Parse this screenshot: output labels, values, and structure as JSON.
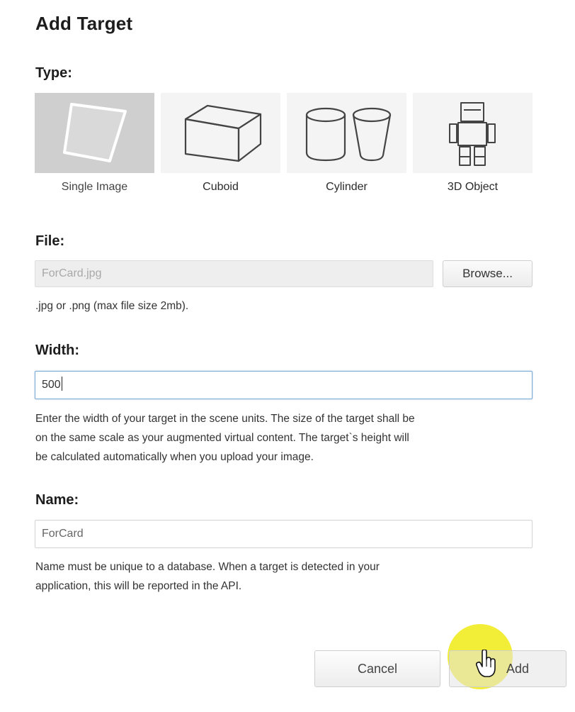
{
  "dialog": {
    "title": "Add Target"
  },
  "type_section": {
    "label": "Type:",
    "selected": "Single Image",
    "options": [
      {
        "label": "Single Image",
        "icon": "single-image-icon"
      },
      {
        "label": "Cuboid",
        "icon": "cuboid-icon"
      },
      {
        "label": "Cylinder",
        "icon": "cylinder-icon"
      },
      {
        "label": "3D Object",
        "icon": "3d-object-icon"
      }
    ]
  },
  "file_section": {
    "label": "File:",
    "value": "ForCard.jpg",
    "browse_label": "Browse...",
    "hint": ".jpg or .png (max file size 2mb)."
  },
  "width_section": {
    "label": "Width:",
    "value": "500",
    "hint_line1": "Enter the width of your target in the scene units. The size of the target shall be",
    "hint_line2": "on the same scale as your augmented virtual content. The target`s height will",
    "hint_line3": "be calculated automatically when you upload your image."
  },
  "name_section": {
    "label": "Name:",
    "value": "ForCard",
    "hint_line1": "Name must be unique to a database. When a target is detected in your",
    "hint_line2": "application, this will be reported in the API."
  },
  "footer": {
    "cancel_label": "Cancel",
    "add_label": "Add"
  },
  "colors": {
    "selected_tile": "#cfcfcf",
    "tile": "#f4f4f4",
    "focus_border": "#7aaad6",
    "click_highlight": "#f0eb14"
  }
}
